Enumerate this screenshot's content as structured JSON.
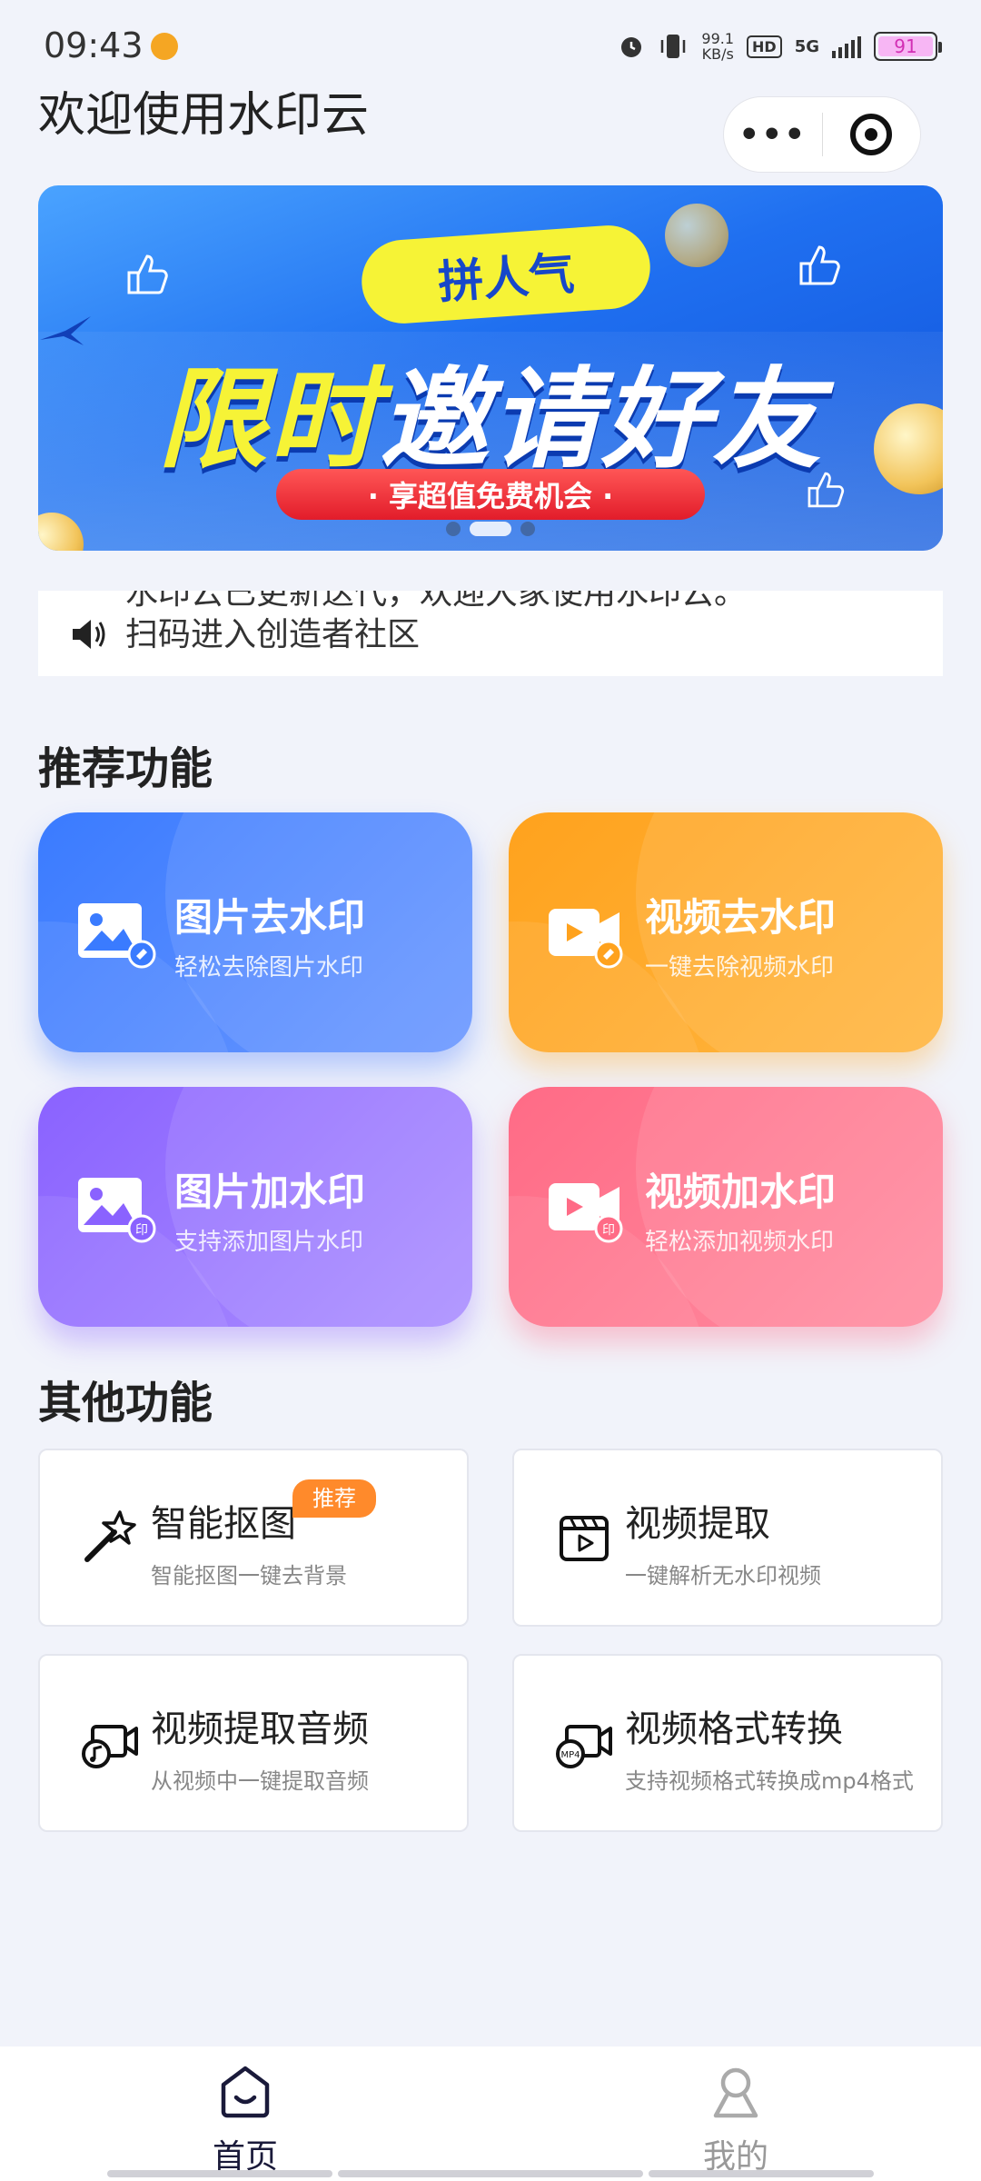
{
  "status_bar": {
    "time": "09:43",
    "net_speed_value": "99.1",
    "net_speed_unit": "KB/s",
    "hd": "HD",
    "network": "5G",
    "battery": "91"
  },
  "header": {
    "title": "欢迎使用水印云",
    "more_label": "•••"
  },
  "banner": {
    "tag": "拼人气",
    "headline_highlight": "限时",
    "headline_rest": "邀请好友",
    "subline": "· 享超值免费机会 ·",
    "pages": 3,
    "active_page": 2
  },
  "notice": {
    "line1": "水印云已更新迭代，欢迎大家使用水印云。",
    "line2": "扫码进入创造者社区"
  },
  "recommended": {
    "title": "推荐功能",
    "items": [
      {
        "title": "图片去水印",
        "subtitle": "轻松去除图片水印",
        "icon": "image-remove-icon",
        "color": "#3a7bff"
      },
      {
        "title": "视频去水印",
        "subtitle": "一键去除视频水印",
        "icon": "video-remove-icon",
        "color": "#ffa21d"
      },
      {
        "title": "图片加水印",
        "subtitle": "支持添加图片水印",
        "icon": "image-add-watermark-icon",
        "color": "#8a62ff"
      },
      {
        "title": "视频加水印",
        "subtitle": "轻松添加视频水印",
        "icon": "video-add-watermark-icon",
        "color": "#ff6b86"
      }
    ]
  },
  "other": {
    "title": "其他功能",
    "items": [
      {
        "title": "智能抠图",
        "subtitle": "智能抠图一键去背景",
        "icon": "magic-wand-icon",
        "badge": "推荐"
      },
      {
        "title": "视频提取",
        "subtitle": "一键解析无水印视频",
        "icon": "video-clapper-icon"
      },
      {
        "title": "视频提取音频",
        "subtitle": "从视频中一键提取音频",
        "icon": "video-audio-icon"
      },
      {
        "title": "视频格式转换",
        "subtitle": "支持视频格式转换成mp4格式",
        "icon": "video-mp4-icon"
      }
    ]
  },
  "tabbar": {
    "home_label": "首页",
    "mine_label": "我的"
  }
}
